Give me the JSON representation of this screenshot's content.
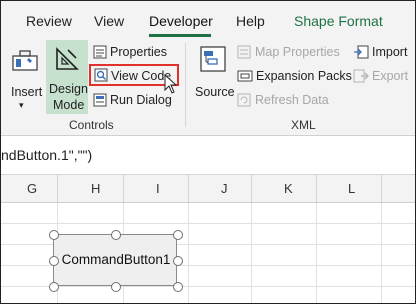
{
  "tabs": {
    "review": "Review",
    "view": "View",
    "developer": "Developer",
    "help": "Help",
    "shape_format": "Shape Format"
  },
  "controls_group": {
    "insert": "Insert",
    "design_mode_line1": "Design",
    "design_mode_line2": "Mode",
    "properties": "Properties",
    "view_code": "View Code",
    "run_dialog": "Run Dialog",
    "label": "Controls"
  },
  "xml_group": {
    "source": "Source",
    "map_properties": "Map Properties",
    "expansion_packs": "Expansion Packs",
    "refresh_data": "Refresh Data",
    "import": "Import",
    "export": "Export",
    "label": "XML"
  },
  "formula_bar": {
    "text": "ndButton.1\",\"\")"
  },
  "columns": [
    "G",
    "H",
    "I",
    "J",
    "K",
    "L"
  ],
  "command_button": {
    "label": "CommandButton1"
  },
  "colors": {
    "accent": "#1e7145",
    "highlight_box": "#e0312f",
    "design_mode_bg": "#c7e1cf"
  }
}
